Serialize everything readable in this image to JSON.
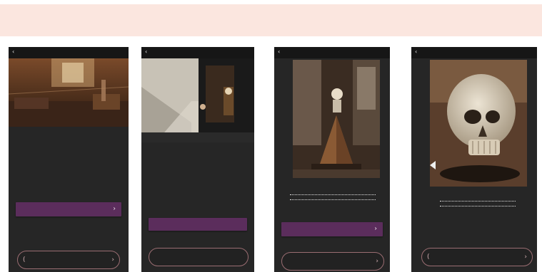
{
  "steps": [
    {
      "number": "",
      "description": ""
    },
    {
      "number": "",
      "description": ""
    },
    {
      "number": "",
      "description": ""
    },
    {
      "number": "",
      "description": ""
    }
  ],
  "screens": [
    {
      "status": "",
      "hero_title": "",
      "heading": "",
      "paragraph": "",
      "primary_button": "",
      "secondary_button": ""
    },
    {
      "status": "",
      "heading": "",
      "paragraph": "",
      "primary_button": "",
      "secondary_button": ""
    },
    {
      "status": "",
      "caption": "",
      "primary_button": "",
      "secondary_button": ""
    },
    {
      "status": "",
      "caption": "",
      "secondary_button": ""
    }
  ],
  "colors": {
    "accent_purple": "#5b2d5c",
    "header_band": "#fbe6df",
    "screen_bg": "#262626"
  },
  "icons": {
    "back": "chevron-left-icon",
    "primary_chevron": "chevron-right-icon",
    "pill_left": "arrow-left-icon",
    "pill_right": "arrow-right-icon",
    "audio_play": "play-icon"
  }
}
